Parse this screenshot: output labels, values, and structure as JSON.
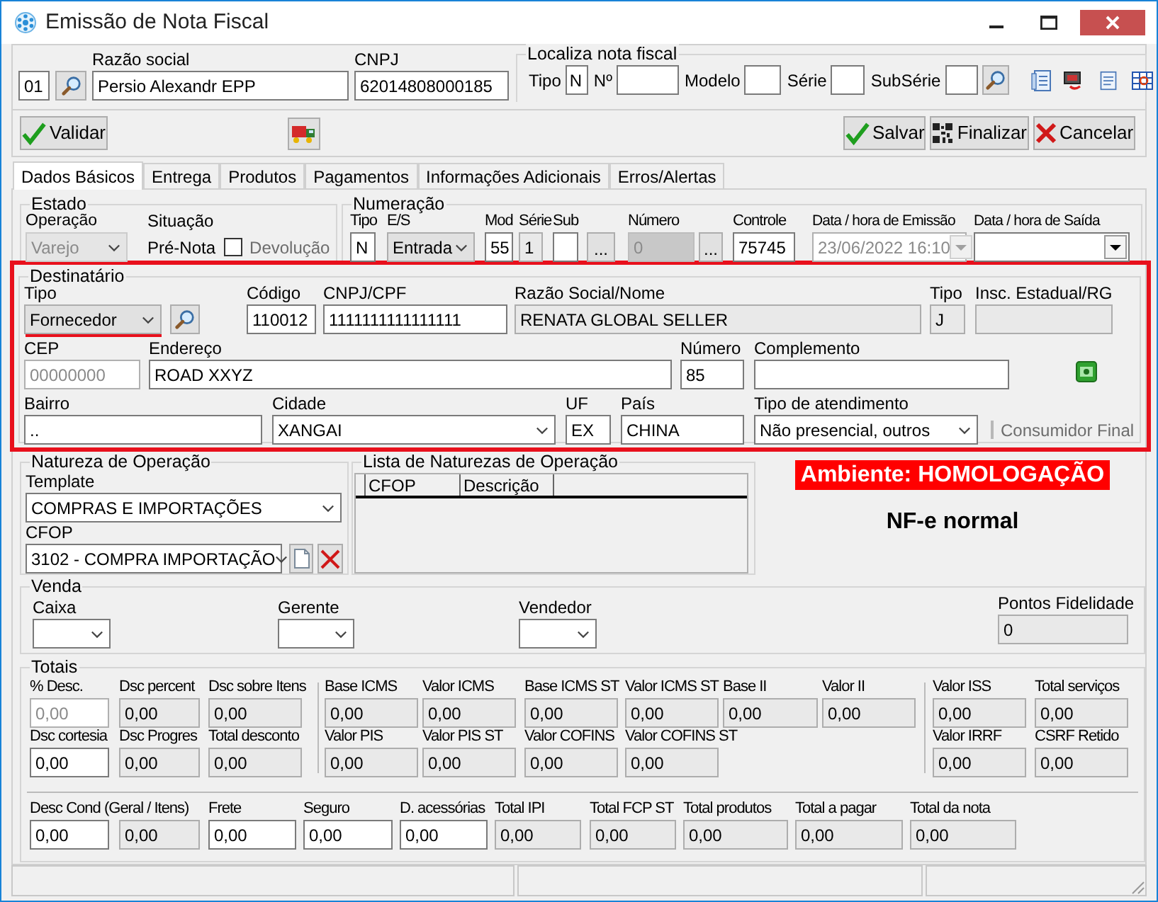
{
  "window": {
    "title": "Emissão de Nota Fiscal"
  },
  "company": {
    "code": {
      "kind": "text",
      "value": "01",
      "readonly": false,
      "disabled": false
    },
    "fields": [
      {
        "kind": "text",
        "label": "Razão social",
        "value": "Persio Alexandr EPP",
        "readonly": false,
        "disabled": false
      },
      {
        "kind": "text",
        "label": "CNPJ",
        "value": "62014808000185",
        "readonly": false,
        "disabled": false
      }
    ]
  },
  "localiza": {
    "title": "Localiza nota fiscal",
    "fields": [
      {
        "label": "Tipo",
        "value": "N"
      },
      {
        "label": "Nº"
      },
      {
        "label": "Modelo"
      },
      {
        "label": "Série"
      },
      {
        "label": "SubSérie"
      }
    ]
  },
  "toolbar": [
    {
      "kind": "validate",
      "label": "Validar"
    },
    {
      "kind": "save",
      "label": "Salvar"
    },
    {
      "kind": "finalize",
      "label": "Finalizar"
    },
    {
      "kind": "cancel",
      "label": "Cancelar"
    }
  ],
  "tabs": [
    {
      "label": "Dados Básicos",
      "selected": true
    },
    {
      "label": "Entrega",
      "selected": false
    },
    {
      "label": "Produtos",
      "selected": false
    },
    {
      "label": "Pagamentos",
      "selected": false
    },
    {
      "label": "Informações Adicionais",
      "selected": false
    },
    {
      "label": "Erros/Alertas",
      "selected": false
    }
  ],
  "estado": {
    "title": "Estado",
    "operacao": {
      "kind": "dropdown",
      "label": "Operação",
      "value": "Varejo",
      "readonly": true,
      "disabled": true
    },
    "situacao": {
      "label": "Situação",
      "value": "Pré-Nota"
    },
    "devolucao": {
      "label": "Devolução",
      "checked": false
    }
  },
  "numeracao": {
    "title": "Numeração",
    "fields": [
      {
        "kind": "text",
        "label": "Tipo",
        "value": "N",
        "readonly": false,
        "disabled": false
      },
      {
        "kind": "dropdown",
        "label": "E/S",
        "value": "Entrada",
        "readonly": false,
        "disabled": false
      },
      {
        "kind": "text",
        "label": "Mod",
        "value": "55",
        "readonly": false,
        "disabled": false
      },
      {
        "kind": "text",
        "label": "Série",
        "value": "1",
        "readonly": true,
        "disabled": false
      },
      {
        "kind": "text",
        "label": "Sub",
        "readonly": false,
        "disabled": false
      },
      {
        "kind": "button",
        "text": "..."
      },
      {
        "kind": "text",
        "label": "Número",
        "value": "0",
        "readonly": true,
        "disabled": true
      },
      {
        "kind": "button",
        "text": "..."
      },
      {
        "kind": "text",
        "label": "Controle",
        "value": "75745",
        "readonly": false,
        "disabled": false
      },
      {
        "kind": "date",
        "label": "Data / hora de Emissão",
        "value": "23/06/2022 16:10",
        "readonly": false,
        "disabled": true
      },
      {
        "kind": "date",
        "label": "Data / hora de Saída",
        "readonly": false,
        "disabled": false
      }
    ]
  },
  "destinatario": {
    "title": "Destinatário",
    "highlighted": true,
    "rows": [
      {
        "fields": [
          {
            "kind": "dropdown",
            "label": "Tipo",
            "value": "Fornecedor",
            "readonly": false,
            "disabled": false,
            "underlined": true
          },
          {
            "kind": "text",
            "label": "Código",
            "value": "110012",
            "readonly": false,
            "disabled": false
          },
          {
            "kind": "text",
            "label": "CNPJ/CPF",
            "value": "1111111111111111",
            "readonly": false,
            "disabled": false
          },
          {
            "kind": "text",
            "label": "Razão Social/Nome",
            "value": "RENATA GLOBAL SELLER",
            "readonly": true,
            "disabled": false
          },
          {
            "kind": "text",
            "label": "Tipo",
            "value": "J",
            "readonly": true,
            "disabled": false
          },
          {
            "kind": "text",
            "label": "Insc. Estadual/RG",
            "readonly": true,
            "disabled": false
          }
        ]
      },
      {
        "fields": [
          {
            "kind": "text",
            "label": "CEP",
            "value": "00000000",
            "readonly": false,
            "disabled": true
          },
          {
            "kind": "text",
            "label": "Endereço",
            "value": "ROAD XXYZ",
            "readonly": false,
            "disabled": false
          },
          {
            "kind": "text",
            "label": "Número",
            "value": "85",
            "readonly": false,
            "disabled": false
          },
          {
            "kind": "text",
            "label": "Complemento",
            "readonly": false,
            "disabled": false
          }
        ]
      },
      {
        "fields": [
          {
            "kind": "text",
            "label": "Bairro",
            "value": "..",
            "readonly": false,
            "disabled": false
          },
          {
            "kind": "combo",
            "label": "Cidade",
            "value": "XANGAI",
            "readonly": false,
            "disabled": false
          },
          {
            "kind": "text",
            "label": "UF",
            "value": "EX",
            "readonly": false,
            "disabled": false
          },
          {
            "kind": "text",
            "label": "País",
            "value": "CHINA",
            "readonly": false,
            "disabled": false
          },
          {
            "kind": "combo",
            "label": "Tipo de atendimento",
            "value": "Não presencial, outros",
            "readonly": false,
            "disabled": false
          },
          {
            "kind": "checkbox",
            "label": "Consumidor Final",
            "checked": false,
            "disabled": true
          }
        ]
      }
    ]
  },
  "natureza": {
    "title": "Natureza de Operação",
    "template": {
      "kind": "combo",
      "label": "Template",
      "value": "COMPRAS E IMPORTAÇÕES",
      "readonly": false,
      "disabled": false
    },
    "cfop": {
      "kind": "combo",
      "label": "CFOP",
      "value": "3102  - COMPRA IMPORTAÇÃO",
      "readonly": false,
      "disabled": false
    }
  },
  "lista": {
    "title": "Lista de Naturezas de Operação",
    "columns": [
      "CFOP",
      "Descrição"
    ]
  },
  "status": {
    "environment": "Ambiente: HOMOLOGAÇÃO",
    "mode": "NF-e normal"
  },
  "venda": {
    "title": "Venda",
    "fields": [
      {
        "kind": "combo",
        "label": "Caixa",
        "readonly": false,
        "disabled": false
      },
      {
        "kind": "combo",
        "label": "Gerente",
        "readonly": false,
        "disabled": false
      },
      {
        "kind": "combo",
        "label": "Vendedor",
        "readonly": false,
        "disabled": false
      },
      {
        "kind": "text",
        "label": "Pontos Fidelidade",
        "value": "0",
        "readonly": true,
        "disabled": false
      }
    ]
  },
  "totais": {
    "title": "Totais",
    "rows": [
      {
        "fields": [
          {
            "kind": "text",
            "label": "% Desc.",
            "value": "0,00",
            "readonly": false,
            "disabled": true
          },
          {
            "kind": "text",
            "label": "Dsc percent",
            "value": "0,00",
            "readonly": true,
            "disabled": false
          },
          {
            "kind": "text",
            "label": "Dsc sobre Itens",
            "value": "0,00",
            "readonly": true,
            "disabled": false
          },
          {
            "kind": "text",
            "label": "Base ICMS",
            "value": "0,00",
            "readonly": true,
            "disabled": false
          },
          {
            "kind": "text",
            "label": "Valor ICMS",
            "value": "0,00",
            "readonly": true,
            "disabled": false
          },
          {
            "kind": "text",
            "label": "Base ICMS ST",
            "value": "0,00",
            "readonly": true,
            "disabled": false
          },
          {
            "kind": "text",
            "label": "Valor ICMS ST",
            "value": "0,00",
            "readonly": true,
            "disabled": false
          },
          {
            "kind": "text",
            "label": "Base II",
            "value": "0,00",
            "readonly": true,
            "disabled": false
          },
          {
            "kind": "text",
            "label": "Valor II",
            "value": "0,00",
            "readonly": true,
            "disabled": false
          },
          {
            "kind": "text",
            "label": "Valor ISS",
            "value": "0,00",
            "readonly": true,
            "disabled": false
          },
          {
            "kind": "text",
            "label": "Total serviços",
            "value": "0,00",
            "readonly": true,
            "disabled": false
          }
        ]
      },
      {
        "fields": [
          {
            "kind": "text",
            "label": "Dsc cortesia",
            "value": "0,00",
            "readonly": false,
            "disabled": false
          },
          {
            "kind": "text",
            "label": "Dsc Progres",
            "value": "0,00",
            "readonly": true,
            "disabled": false
          },
          {
            "kind": "text",
            "label": "Total desconto",
            "value": "0,00",
            "readonly": true,
            "disabled": false
          },
          {
            "kind": "text",
            "label": "Valor PIS",
            "value": "0,00",
            "readonly": true,
            "disabled": false
          },
          {
            "kind": "text",
            "label": "Valor PIS ST",
            "value": "0,00",
            "readonly": true,
            "disabled": false
          },
          {
            "kind": "text",
            "label": "Valor COFINS",
            "value": "0,00",
            "readonly": true,
            "disabled": false
          },
          {
            "kind": "text",
            "label": "Valor COFINS ST",
            "value": "0,00",
            "readonly": true,
            "disabled": false
          },
          {
            "kind": "text",
            "label": "Valor IRRF",
            "value": "0,00",
            "readonly": true,
            "disabled": false
          },
          {
            "kind": "text",
            "label": "CSRF Retido",
            "value": "0,00",
            "readonly": true,
            "disabled": false
          }
        ]
      },
      {
        "fields": [
          {
            "kind": "text",
            "label": "Desc Cond (Geral / Itens)",
            "value": "0,00",
            "readonly": false,
            "disabled": false
          },
          {
            "kind": "text",
            "value": "0,00",
            "readonly": true,
            "disabled": false
          },
          {
            "kind": "text",
            "label": "Frete",
            "value": "0,00",
            "readonly": false,
            "disabled": false
          },
          {
            "kind": "text",
            "label": "Seguro",
            "value": "0,00",
            "readonly": false,
            "disabled": false
          },
          {
            "kind": "text",
            "label": "D. acessórias",
            "value": "0,00",
            "readonly": false,
            "disabled": false
          },
          {
            "kind": "text",
            "label": "Total IPI",
            "value": "0,00",
            "readonly": true,
            "disabled": false
          },
          {
            "kind": "text",
            "label": "Total FCP ST",
            "value": "0,00",
            "readonly": true,
            "disabled": false
          },
          {
            "kind": "text",
            "label": "Total produtos",
            "value": "0,00",
            "readonly": true,
            "disabled": false
          },
          {
            "kind": "text",
            "label": "Total a pagar",
            "value": "0,00",
            "readonly": true,
            "disabled": false
          },
          {
            "kind": "text",
            "label": "Total da nota",
            "value": "0,00",
            "readonly": true,
            "disabled": false
          }
        ]
      }
    ]
  }
}
